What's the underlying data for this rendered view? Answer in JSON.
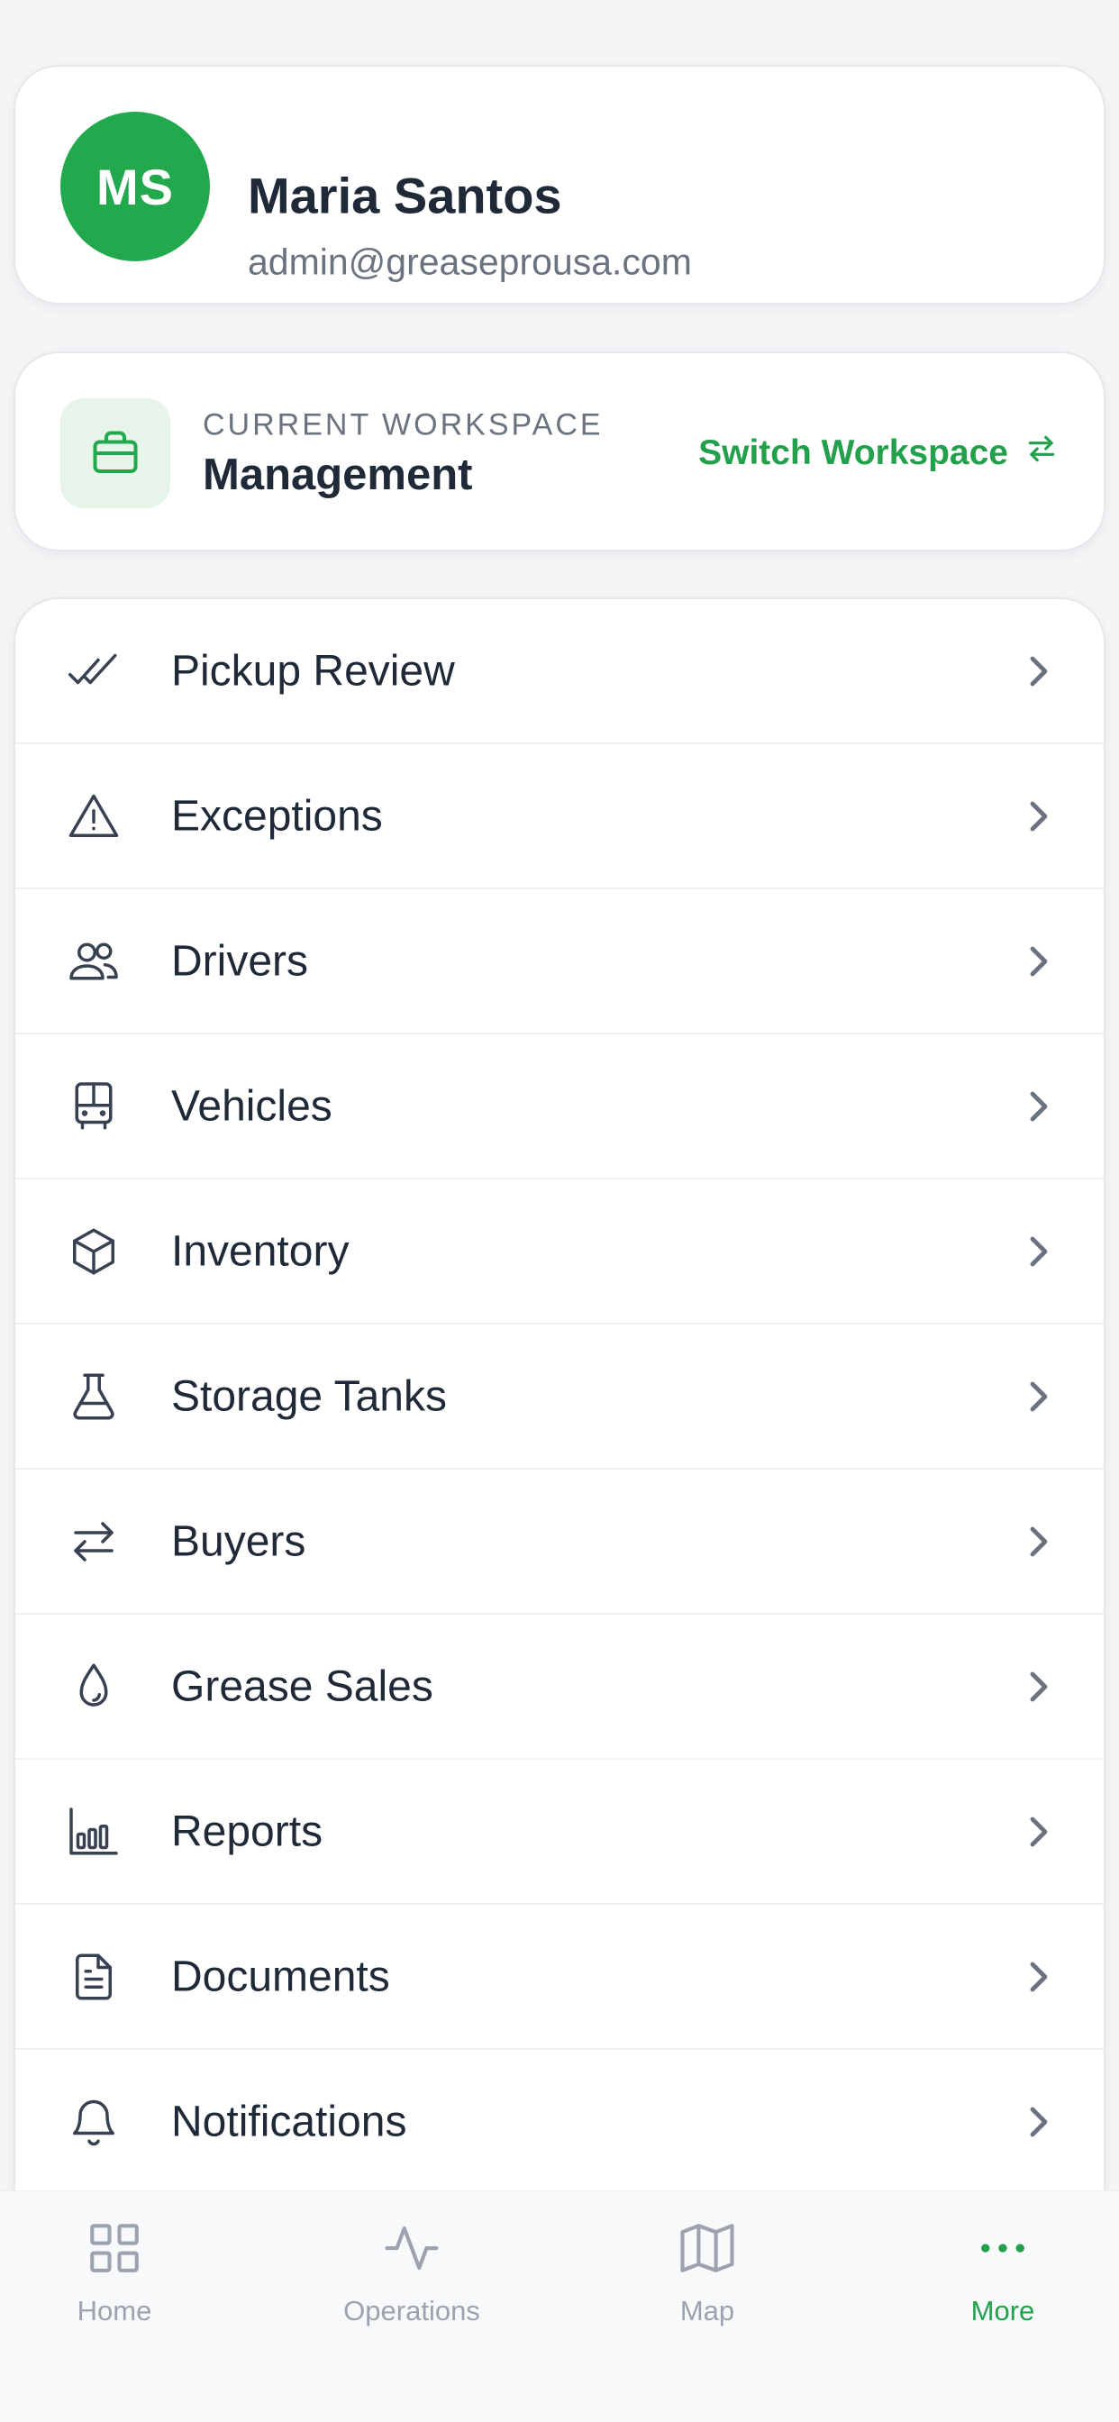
{
  "profile": {
    "initials": "MS",
    "name": "Maria Santos",
    "email": "admin@greaseprousa.com"
  },
  "workspace": {
    "caption": "CURRENT WORKSPACE",
    "name": "Management",
    "switch_label": "Switch Workspace",
    "switch_icon": "arrows-swap-icon",
    "icon": "briefcase-icon"
  },
  "menu": {
    "items": [
      {
        "label": "Pickup Review",
        "icon": "double-check-icon"
      },
      {
        "label": "Exceptions",
        "icon": "warning-triangle-icon"
      },
      {
        "label": "Drivers",
        "icon": "users-icon"
      },
      {
        "label": "Vehicles",
        "icon": "bus-icon"
      },
      {
        "label": "Inventory",
        "icon": "box-icon"
      },
      {
        "label": "Storage Tanks",
        "icon": "flask-icon"
      },
      {
        "label": "Buyers",
        "icon": "arrows-swap-icon"
      },
      {
        "label": "Grease Sales",
        "icon": "droplet-icon"
      },
      {
        "label": "Reports",
        "icon": "bar-chart-icon"
      },
      {
        "label": "Documents",
        "icon": "document-icon"
      },
      {
        "label": "Notifications",
        "icon": "bell-icon"
      }
    ]
  },
  "tabbar": {
    "tabs": [
      {
        "label": "Home",
        "icon": "grid-icon"
      },
      {
        "label": "Operations",
        "icon": "activity-icon"
      },
      {
        "label": "Map",
        "icon": "map-icon"
      },
      {
        "label": "More",
        "icon": "more-dots-icon",
        "active": true
      }
    ]
  },
  "colors": {
    "accent": "#22a84d",
    "accent_text": "#22a04b",
    "text": "#1f2937",
    "muted": "#6b7280",
    "background": "#f4f5f7"
  }
}
